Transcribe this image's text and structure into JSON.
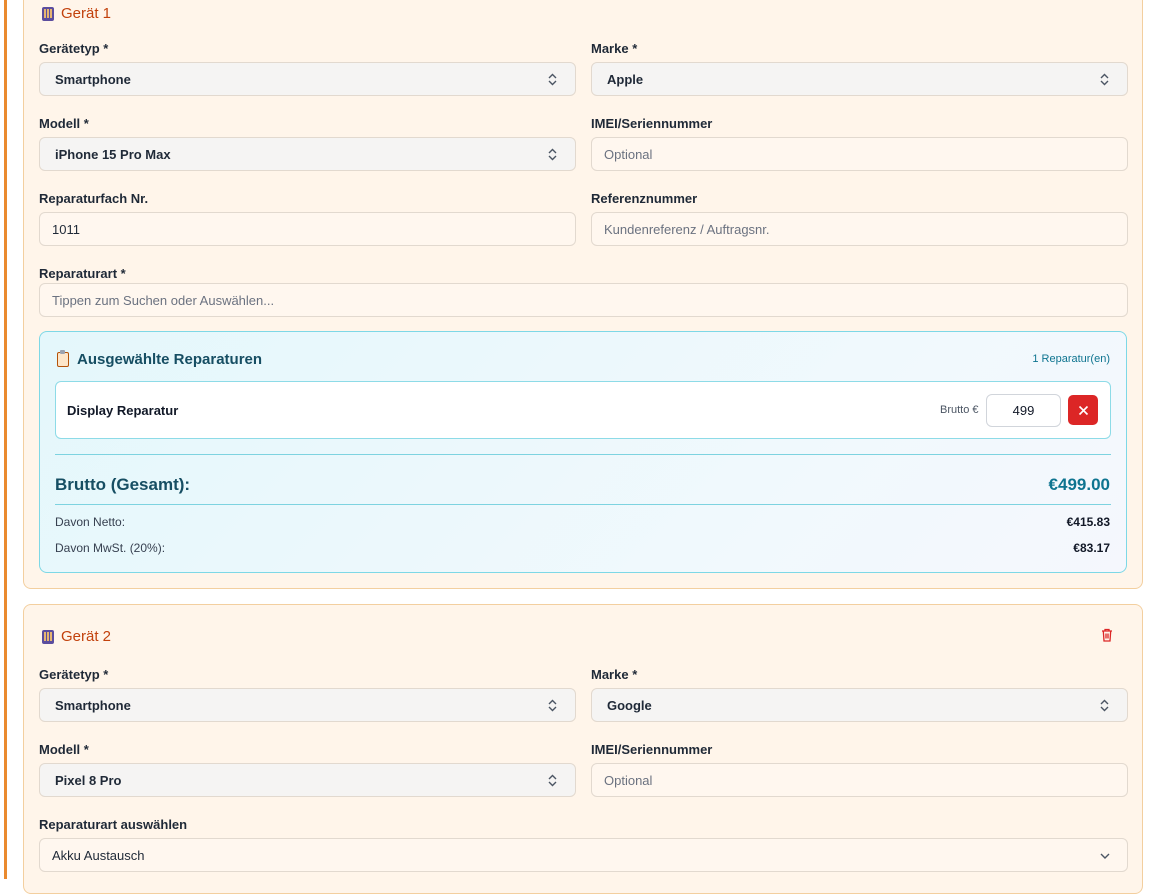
{
  "device1": {
    "title": "Gerät 1",
    "device_type": {
      "label": "Gerätetyp *",
      "value": "Smartphone"
    },
    "brand": {
      "label": "Marke *",
      "value": "Apple"
    },
    "model": {
      "label": "Modell *",
      "value": "iPhone 15 Pro Max"
    },
    "imei": {
      "label": "IMEI/Seriennummer",
      "placeholder": "Optional"
    },
    "repair_slot": {
      "label": "Reparaturfach Nr.",
      "value": "1011"
    },
    "reference": {
      "label": "Referenznummer",
      "placeholder": "Kundenreferenz / Auftragsnr."
    },
    "repair_type": {
      "label": "Reparaturart *",
      "placeholder": "Tippen zum Suchen oder Auswählen..."
    },
    "selected": {
      "title": "Ausgewählte Reparaturen",
      "count": "1 Reparatur(en)",
      "items": [
        {
          "name": "Display Reparatur",
          "price_label": "Brutto €",
          "price": "499"
        }
      ],
      "total_label": "Brutto (Gesamt):",
      "total_value": "€499.00",
      "net_label": "Davon Netto:",
      "net_value": "€415.83",
      "vat_label": "Davon MwSt. (20%):",
      "vat_value": "€83.17"
    }
  },
  "device2": {
    "title": "Gerät 2",
    "device_type": {
      "label": "Gerätetyp *",
      "value": "Smartphone"
    },
    "brand": {
      "label": "Marke *",
      "value": "Google"
    },
    "model": {
      "label": "Modell *",
      "value": "Pixel 8 Pro"
    },
    "imei": {
      "label": "IMEI/Seriennummer",
      "placeholder": "Optional"
    },
    "repair_type": {
      "label": "Reparaturart auswählen",
      "value": "Akku Austausch"
    }
  },
  "icons": {
    "device": "tablet-icon",
    "clipboard": "clipboard-icon",
    "remove": "close-icon",
    "delete": "trash-icon",
    "select": "updown-chevron-icon"
  },
  "colors": {
    "accent": "#ea8a2e",
    "title": "#c2410c",
    "danger": "#dc2626",
    "teal": "#0e7490"
  }
}
